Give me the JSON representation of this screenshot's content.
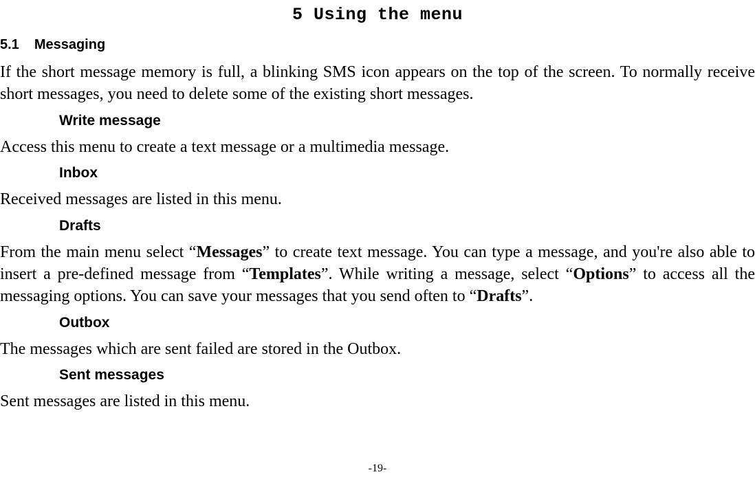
{
  "title": "5  Using the menu",
  "section": {
    "number": "5.1",
    "name": "Messaging"
  },
  "intro": "If the short message memory is full, a blinking SMS icon appears on the top of the screen. To normally receive short messages, you need to delete some of the existing short messages.",
  "items": {
    "write": {
      "heading": "Write message",
      "body": "Access this menu to create a text message or a multimedia message."
    },
    "inbox": {
      "heading": "Inbox",
      "body": "Received messages are listed in this menu."
    },
    "drafts": {
      "heading": "Drafts",
      "body_parts": {
        "p1": "From the main menu select “",
        "b1": "Messages",
        "p2": "” to create text message. You can type a message, and you're also able to insert a pre-defined message from “",
        "b2": "Templates",
        "p3": "”. While writing a message, select “",
        "b3": "Options",
        "p4": "” to access all the messaging options. You can save your messages that you send often to “",
        "b4": "Drafts",
        "p5": "”."
      }
    },
    "outbox": {
      "heading": "Outbox",
      "body": "The messages which are sent failed are stored in the Outbox."
    },
    "sent": {
      "heading": "Sent messages",
      "body": "Sent messages are listed in this menu."
    }
  },
  "page_number": "-19-"
}
